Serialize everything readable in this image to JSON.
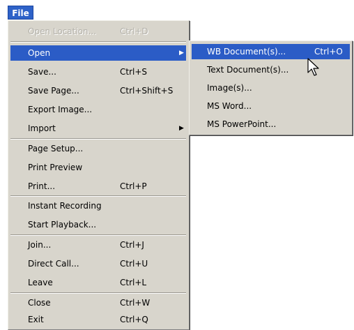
{
  "menubar": {
    "file_label": "File"
  },
  "file_menu": {
    "open_location": {
      "label": "Open Location...",
      "shortcut": "Ctrl+D"
    },
    "open": {
      "label": "Open"
    },
    "save": {
      "label": "Save...",
      "shortcut": "Ctrl+S"
    },
    "save_page": {
      "label": "Save Page...",
      "shortcut": "Ctrl+Shift+S"
    },
    "export_image": {
      "label": "Export Image..."
    },
    "import": {
      "label": "Import"
    },
    "page_setup": {
      "label": "Page Setup..."
    },
    "print_preview": {
      "label": "Print Preview"
    },
    "print": {
      "label": "Print...",
      "shortcut": "Ctrl+P"
    },
    "instant_recording": {
      "label": "Instant Recording"
    },
    "start_playback": {
      "label": "Start Playback..."
    },
    "join": {
      "label": "Join...",
      "shortcut": "Ctrl+J"
    },
    "direct_call": {
      "label": "Direct Call...",
      "shortcut": "Ctrl+U"
    },
    "leave": {
      "label": "Leave",
      "shortcut": "Ctrl+L"
    },
    "close": {
      "label": "Close",
      "shortcut": "Ctrl+W"
    },
    "exit": {
      "label": "Exit",
      "shortcut": "Ctrl+Q"
    }
  },
  "open_submenu": {
    "wb_documents": {
      "label": "WB Document(s)...",
      "shortcut": "Ctrl+O"
    },
    "text_documents": {
      "label": "Text Document(s)..."
    },
    "images": {
      "label": "Image(s)..."
    },
    "ms_word": {
      "label": "MS Word..."
    },
    "ms_powerpoint": {
      "label": "MS PowerPoint..."
    }
  },
  "colors": {
    "highlight": "#2b5cc6",
    "menu_background": "#d8d5cc",
    "disabled_text": "#b3b1aa"
  },
  "icons": {
    "submenu_arrow": "triangle-right-icon",
    "cursor": "mouse-pointer-icon"
  }
}
